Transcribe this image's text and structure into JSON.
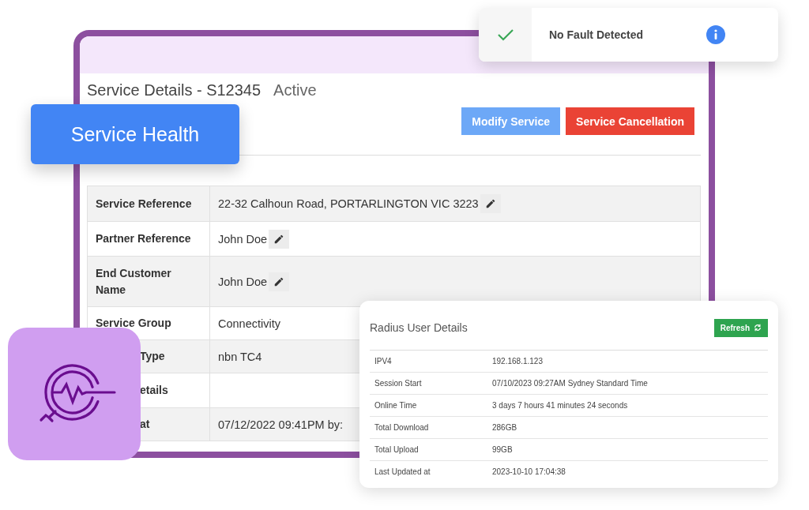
{
  "service_details": {
    "title": "Service Details - S12345",
    "status": "Active",
    "buttons": [
      {
        "label": "Modify Service",
        "kind": "primary"
      },
      {
        "label": "Service Cancellation",
        "kind": "danger"
      }
    ],
    "rows": [
      {
        "label": "Service Reference",
        "value": "22-32 Calhoun Road, PORTARLINGTON VIC 3223",
        "editable": true
      },
      {
        "label": "Partner Reference",
        "value": "John Doe",
        "editable": true
      },
      {
        "label": "End Customer Name",
        "value": "John Doe",
        "editable": true
      },
      {
        "label": "Service Group",
        "value": "Connectivity",
        "editable": false
      },
      {
        "label": "Type",
        "value": "nbn TC4",
        "editable": false
      },
      {
        "label": "etails",
        "value": "",
        "editable": false
      },
      {
        "label": "at",
        "value": "07/12/2022 09:41PM by:",
        "editable": false
      }
    ]
  },
  "badge": {
    "label": "Service Health"
  },
  "notification": {
    "message": "No Fault Detected"
  },
  "radius": {
    "title": "Radius User Details",
    "button": "Refresh",
    "rows": [
      {
        "label": "IPV4",
        "value": "192.168.1.123"
      },
      {
        "label": "Session Start",
        "value": "07/10/2023 09:27AM Sydney Standard Time"
      },
      {
        "label": "Online Time",
        "value": "3 days 7 hours 41 minutes 24 seconds"
      },
      {
        "label": "Total Download",
        "value": "286GB"
      },
      {
        "label": "Total Upload",
        "value": "99GB"
      },
      {
        "label": "Last Updated at",
        "value": "2023-10-10 17:04:38"
      }
    ]
  }
}
